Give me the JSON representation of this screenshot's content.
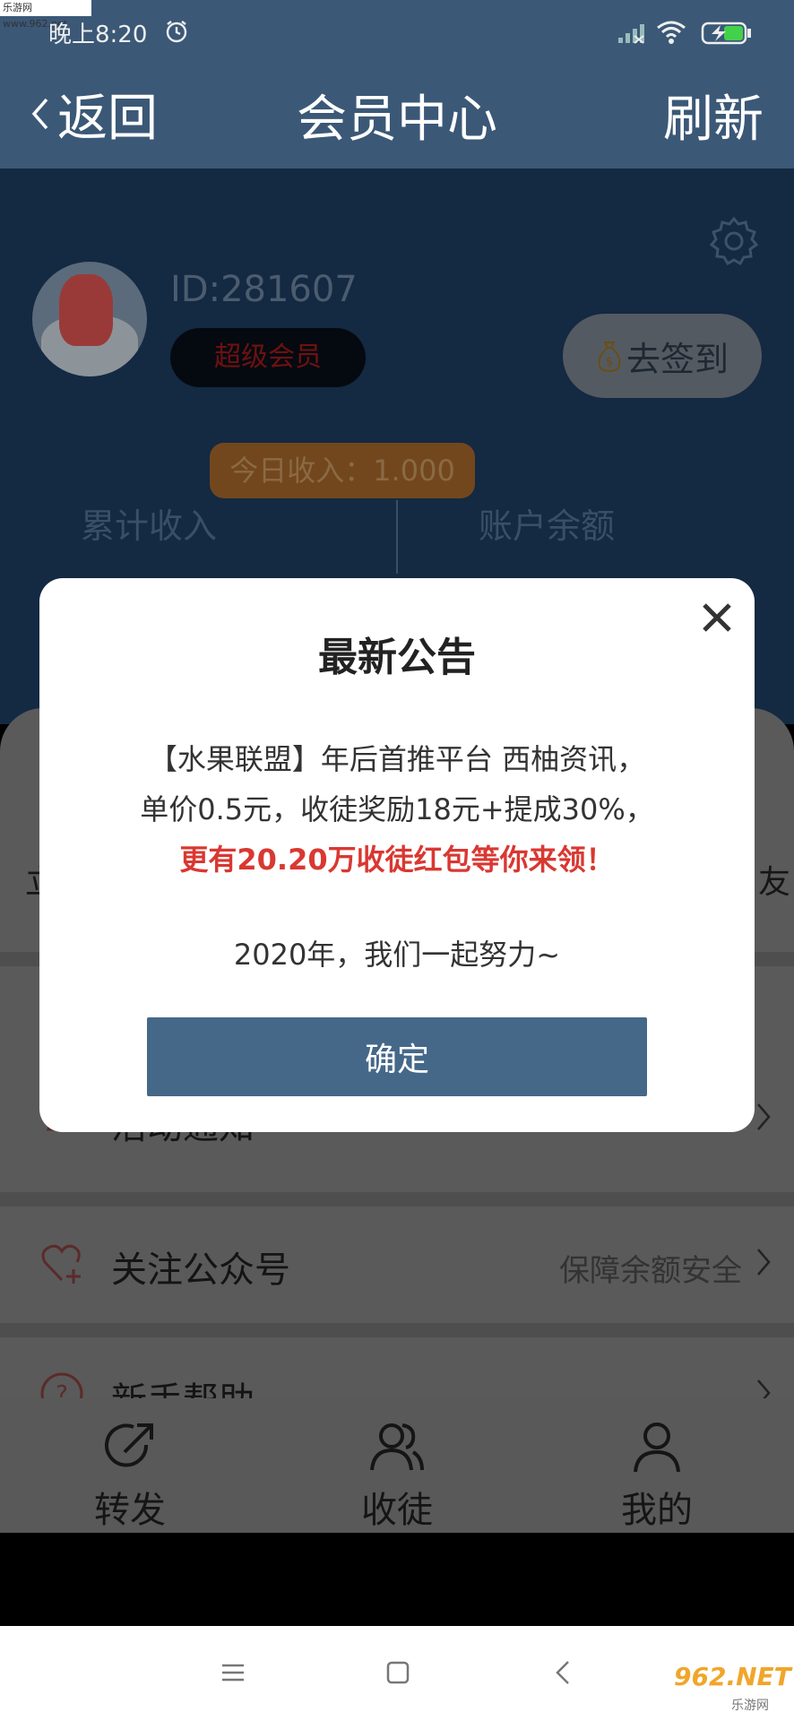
{
  "watermark": "乐游网 www.962.net",
  "status_bar": {
    "time": "晚上8:20"
  },
  "nav": {
    "back_label": "返回",
    "title": "会员中心",
    "refresh_label": "刷新"
  },
  "profile": {
    "id_text": "ID:281607",
    "vip_badge": "超级会员",
    "signin_label": "去签到",
    "today_income": "今日收入：1.000",
    "stat_left_label": "累计收入",
    "stat_right_label": "账户余额"
  },
  "edge_glyphs": {
    "left": "立",
    "right": "友"
  },
  "menu": {
    "activity": {
      "label": "活动通知"
    },
    "follow": {
      "label": "关注公众号",
      "hint": "保障余额安全"
    },
    "help": {
      "label": "新手帮助"
    }
  },
  "tabs": [
    {
      "label": "转发",
      "icon": "share-icon"
    },
    {
      "label": "收徒",
      "icon": "users-icon"
    },
    {
      "label": "我的",
      "icon": "user-icon"
    }
  ],
  "brand": {
    "logo_text": "962.NET",
    "sub_text": "乐游网"
  },
  "dialog": {
    "title": "最新公告",
    "line1": "【水果联盟】年后首推平台 西柚资讯，",
    "line2": "单价0.5元，收徒奖励18元+提成30%，",
    "line3_highlight": "更有20.20万收徒红包等你来领！",
    "line4": "2020年，我们一起努力~",
    "confirm_label": "确定"
  },
  "colors": {
    "header_bg": "#3b5877",
    "button_bg": "#456889",
    "highlight_red": "#d93832"
  }
}
